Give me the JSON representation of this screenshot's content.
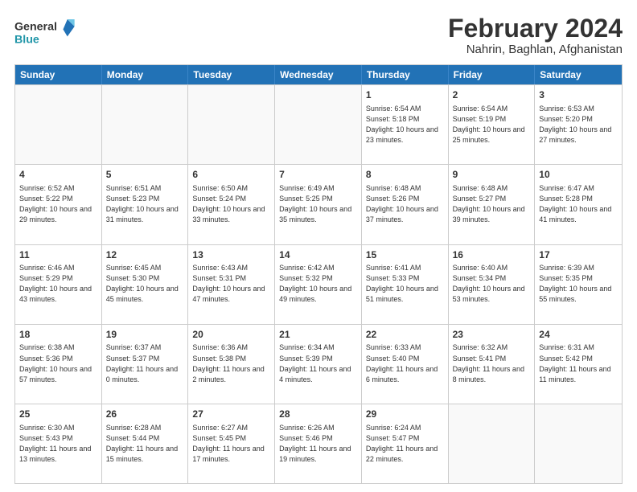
{
  "header": {
    "logo_line1": "General",
    "logo_line2": "Blue",
    "month_year": "February 2024",
    "location": "Nahrin, Baghlan, Afghanistan"
  },
  "weekdays": [
    "Sunday",
    "Monday",
    "Tuesday",
    "Wednesday",
    "Thursday",
    "Friday",
    "Saturday"
  ],
  "rows": [
    [
      {
        "day": "",
        "info": "",
        "empty": true
      },
      {
        "day": "",
        "info": "",
        "empty": true
      },
      {
        "day": "",
        "info": "",
        "empty": true
      },
      {
        "day": "",
        "info": "",
        "empty": true
      },
      {
        "day": "1",
        "info": "Sunrise: 6:54 AM\nSunset: 5:18 PM\nDaylight: 10 hours\nand 23 minutes."
      },
      {
        "day": "2",
        "info": "Sunrise: 6:54 AM\nSunset: 5:19 PM\nDaylight: 10 hours\nand 25 minutes."
      },
      {
        "day": "3",
        "info": "Sunrise: 6:53 AM\nSunset: 5:20 PM\nDaylight: 10 hours\nand 27 minutes."
      }
    ],
    [
      {
        "day": "4",
        "info": "Sunrise: 6:52 AM\nSunset: 5:22 PM\nDaylight: 10 hours\nand 29 minutes."
      },
      {
        "day": "5",
        "info": "Sunrise: 6:51 AM\nSunset: 5:23 PM\nDaylight: 10 hours\nand 31 minutes."
      },
      {
        "day": "6",
        "info": "Sunrise: 6:50 AM\nSunset: 5:24 PM\nDaylight: 10 hours\nand 33 minutes."
      },
      {
        "day": "7",
        "info": "Sunrise: 6:49 AM\nSunset: 5:25 PM\nDaylight: 10 hours\nand 35 minutes."
      },
      {
        "day": "8",
        "info": "Sunrise: 6:48 AM\nSunset: 5:26 PM\nDaylight: 10 hours\nand 37 minutes."
      },
      {
        "day": "9",
        "info": "Sunrise: 6:48 AM\nSunset: 5:27 PM\nDaylight: 10 hours\nand 39 minutes."
      },
      {
        "day": "10",
        "info": "Sunrise: 6:47 AM\nSunset: 5:28 PM\nDaylight: 10 hours\nand 41 minutes."
      }
    ],
    [
      {
        "day": "11",
        "info": "Sunrise: 6:46 AM\nSunset: 5:29 PM\nDaylight: 10 hours\nand 43 minutes."
      },
      {
        "day": "12",
        "info": "Sunrise: 6:45 AM\nSunset: 5:30 PM\nDaylight: 10 hours\nand 45 minutes."
      },
      {
        "day": "13",
        "info": "Sunrise: 6:43 AM\nSunset: 5:31 PM\nDaylight: 10 hours\nand 47 minutes."
      },
      {
        "day": "14",
        "info": "Sunrise: 6:42 AM\nSunset: 5:32 PM\nDaylight: 10 hours\nand 49 minutes."
      },
      {
        "day": "15",
        "info": "Sunrise: 6:41 AM\nSunset: 5:33 PM\nDaylight: 10 hours\nand 51 minutes."
      },
      {
        "day": "16",
        "info": "Sunrise: 6:40 AM\nSunset: 5:34 PM\nDaylight: 10 hours\nand 53 minutes."
      },
      {
        "day": "17",
        "info": "Sunrise: 6:39 AM\nSunset: 5:35 PM\nDaylight: 10 hours\nand 55 minutes."
      }
    ],
    [
      {
        "day": "18",
        "info": "Sunrise: 6:38 AM\nSunset: 5:36 PM\nDaylight: 10 hours\nand 57 minutes."
      },
      {
        "day": "19",
        "info": "Sunrise: 6:37 AM\nSunset: 5:37 PM\nDaylight: 11 hours\nand 0 minutes."
      },
      {
        "day": "20",
        "info": "Sunrise: 6:36 AM\nSunset: 5:38 PM\nDaylight: 11 hours\nand 2 minutes."
      },
      {
        "day": "21",
        "info": "Sunrise: 6:34 AM\nSunset: 5:39 PM\nDaylight: 11 hours\nand 4 minutes."
      },
      {
        "day": "22",
        "info": "Sunrise: 6:33 AM\nSunset: 5:40 PM\nDaylight: 11 hours\nand 6 minutes."
      },
      {
        "day": "23",
        "info": "Sunrise: 6:32 AM\nSunset: 5:41 PM\nDaylight: 11 hours\nand 8 minutes."
      },
      {
        "day": "24",
        "info": "Sunrise: 6:31 AM\nSunset: 5:42 PM\nDaylight: 11 hours\nand 11 minutes."
      }
    ],
    [
      {
        "day": "25",
        "info": "Sunrise: 6:30 AM\nSunset: 5:43 PM\nDaylight: 11 hours\nand 13 minutes."
      },
      {
        "day": "26",
        "info": "Sunrise: 6:28 AM\nSunset: 5:44 PM\nDaylight: 11 hours\nand 15 minutes."
      },
      {
        "day": "27",
        "info": "Sunrise: 6:27 AM\nSunset: 5:45 PM\nDaylight: 11 hours\nand 17 minutes."
      },
      {
        "day": "28",
        "info": "Sunrise: 6:26 AM\nSunset: 5:46 PM\nDaylight: 11 hours\nand 19 minutes."
      },
      {
        "day": "29",
        "info": "Sunrise: 6:24 AM\nSunset: 5:47 PM\nDaylight: 11 hours\nand 22 minutes."
      },
      {
        "day": "",
        "info": "",
        "empty": true
      },
      {
        "day": "",
        "info": "",
        "empty": true
      }
    ]
  ]
}
